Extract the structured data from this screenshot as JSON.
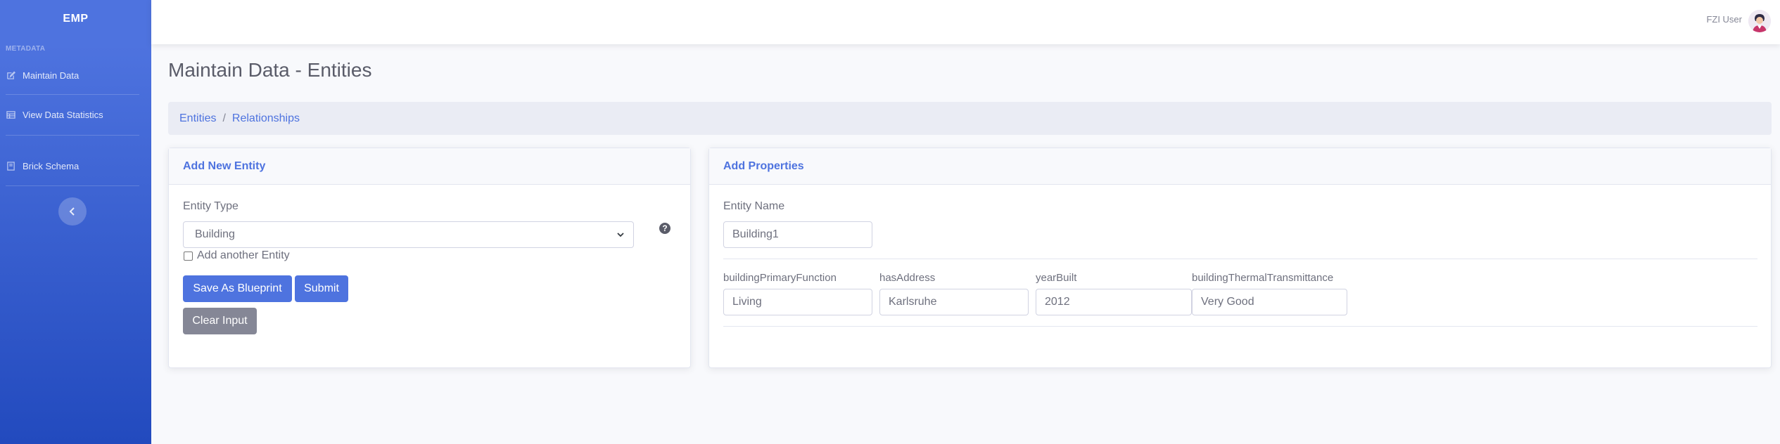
{
  "sidebar": {
    "brand": "EMP",
    "heading": "METADATA",
    "items": [
      {
        "label": "Maintain Data",
        "icon": "edit-icon"
      },
      {
        "label": "View Data Statistics",
        "icon": "table-icon"
      },
      {
        "label": "Brick Schema",
        "icon": "book-icon"
      }
    ]
  },
  "topbar": {
    "user_name": "FZI User"
  },
  "page": {
    "title": "Maintain Data - Entities"
  },
  "breadcrumb": [
    "Entities",
    "Relationships"
  ],
  "left_card": {
    "title": "Add New Entity",
    "entity_type_label": "Entity Type",
    "entity_type_value": "Building",
    "help": "?",
    "add_another_label": "Add another Entity",
    "save_blueprint": "Save As Blueprint",
    "submit": "Submit",
    "clear_input": "Clear Input"
  },
  "right_card": {
    "title": "Add Properties",
    "entity_name_label": "Entity Name",
    "entity_name_value": "Building1",
    "properties": [
      {
        "label": "buildingPrimaryFunction",
        "value": "Living"
      },
      {
        "label": "hasAddress",
        "value": "Karlsruhe"
      },
      {
        "label": "yearBuilt",
        "value": "2012"
      },
      {
        "label": "buildingThermalTransmittance",
        "value": "Very Good"
      }
    ]
  },
  "colors": {
    "primary": "#4e73df",
    "secondary": "#858796",
    "sidebar_dark": "#224abe"
  }
}
